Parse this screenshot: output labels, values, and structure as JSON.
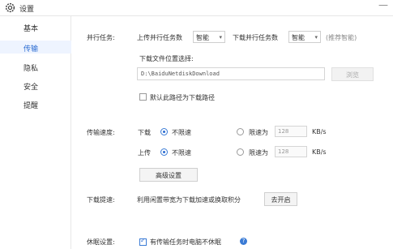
{
  "window": {
    "title": "设置",
    "close_symbol": "—"
  },
  "sidebar": {
    "items": [
      {
        "label": "基本"
      },
      {
        "label": "传输"
      },
      {
        "label": "隐私"
      },
      {
        "label": "安全"
      },
      {
        "label": "提醒"
      }
    ],
    "active_index": 1
  },
  "parallel": {
    "section_label": "并行任务:",
    "upload_label": "上传并行任务数",
    "upload_value": "智能",
    "download_label": "下载并行任务数",
    "download_value": "智能",
    "hint": "(推荐智能)"
  },
  "download_location": {
    "label": "下载文件位置选择:",
    "path": "D:\\BaiduNetdiskDownload",
    "browse_label": "浏览",
    "default_checkbox_label": "默认此路径为下载路径",
    "default_checked": false
  },
  "speed": {
    "section_label": "传输速度:",
    "download_label": "下载",
    "upload_label": "上传",
    "unlimited_label": "不限速",
    "limit_label": "限速为",
    "download_limit_value": "128",
    "upload_limit_value": "128",
    "unit": "KB/s",
    "download_mode": "unlimited",
    "upload_mode": "unlimited",
    "advanced_button": "高级设置"
  },
  "boost": {
    "section_label": "下载提速:",
    "description": "利用闲置带宽为下载加速或换取积分",
    "button_label": "去开启"
  },
  "sleep": {
    "section_label": "休眠设置:",
    "checkbox_label": "有传输任务时电脑不休眠",
    "checked": true,
    "help_symbol": "?"
  },
  "colors": {
    "accent": "#2a6bd1",
    "active_bg": "#eef4ff"
  }
}
